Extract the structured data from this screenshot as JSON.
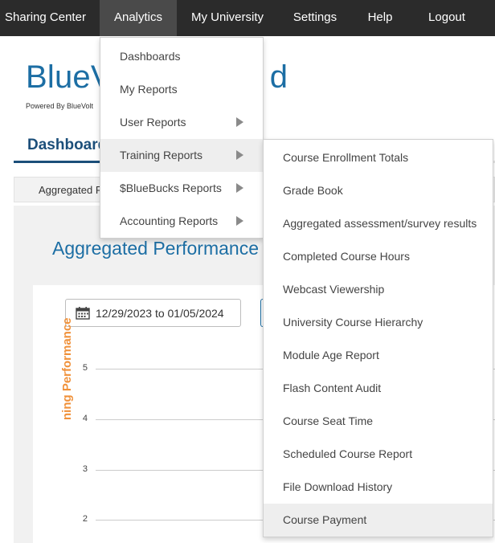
{
  "nav": {
    "items": [
      "Sharing Center",
      "Analytics",
      "My University",
      "Settings",
      "Help",
      "Logout"
    ],
    "active": "Analytics"
  },
  "brand": {
    "title_visible": "BlueV",
    "title_tail": "d",
    "powered": "Powered By BlueVolt"
  },
  "tabs": {
    "active_label": "Dashboard"
  },
  "subtab": {
    "label": "Aggregated P"
  },
  "panel": {
    "title": "Aggregated Performance",
    "date_range": "12/29/2023 to 01/05/2024",
    "y_axis_label": "ning Performance",
    "y_ticks": [
      "5",
      "4",
      "3",
      "2"
    ]
  },
  "analytics_menu": {
    "items": [
      {
        "label": "Dashboards",
        "has_submenu": false
      },
      {
        "label": "My Reports",
        "has_submenu": false
      },
      {
        "label": "User Reports",
        "has_submenu": true
      },
      {
        "label": "Training Reports",
        "has_submenu": true
      },
      {
        "label": "$BlueBucks Reports",
        "has_submenu": true
      },
      {
        "label": "Accounting Reports",
        "has_submenu": true
      }
    ],
    "highlighted": "Training Reports"
  },
  "training_menu": {
    "items": [
      "Course Enrollment Totals",
      "Grade Book",
      "Aggregated assessment/survey results",
      "Completed Course Hours",
      "Webcast Viewership",
      "University Course Hierarchy",
      "Module Age Report",
      "Flash Content Audit",
      "Course Seat Time",
      "Scheduled Course Report",
      "File Download History",
      "Course Payment"
    ],
    "highlighted": "Course Payment"
  },
  "colors": {
    "nav_bg": "#2b2b2b",
    "brand_blue": "#1c6ea4",
    "axis_label_orange": "#f0913a"
  }
}
